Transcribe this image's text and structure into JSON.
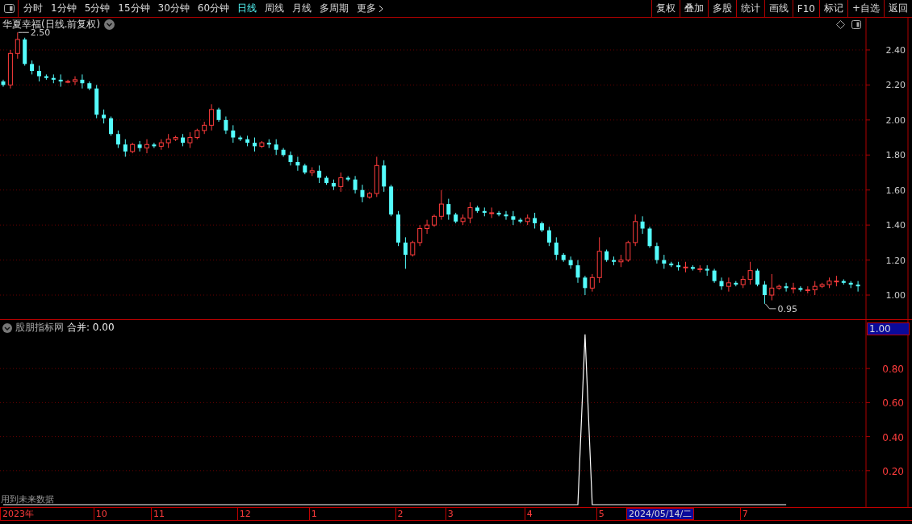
{
  "toolbar": {
    "periods": [
      {
        "label": "分时",
        "selected": false
      },
      {
        "label": "1分钟",
        "selected": false
      },
      {
        "label": "5分钟",
        "selected": false
      },
      {
        "label": "15分钟",
        "selected": false
      },
      {
        "label": "30分钟",
        "selected": false
      },
      {
        "label": "60分钟",
        "selected": false
      },
      {
        "label": "日线",
        "selected": true
      },
      {
        "label": "周线",
        "selected": false
      },
      {
        "label": "月线",
        "selected": false
      },
      {
        "label": "多周期",
        "selected": false
      },
      {
        "label": "更多",
        "selected": false
      }
    ],
    "buttons": [
      "复权",
      "叠加",
      "多股",
      "统计",
      "画线",
      "F10",
      "标记",
      "+自选",
      "返回"
    ]
  },
  "price_chart": {
    "title": "华夏幸福(日线.前复权)",
    "chart_data": {
      "type": "candlestick",
      "grid": true,
      "ylim": [
        0.862,
        2.584
      ],
      "yticks": [
        {
          "value": 2.4,
          "label": "2.40"
        },
        {
          "value": 2.2,
          "label": "2.20"
        },
        {
          "value": 2.0,
          "label": "2.00"
        },
        {
          "value": 1.8,
          "label": "1.80"
        },
        {
          "value": 1.6,
          "label": "1.60"
        },
        {
          "value": 1.4,
          "label": "1.40"
        },
        {
          "value": 1.2,
          "label": "1.20"
        },
        {
          "value": 1.0,
          "label": "1.00"
        }
      ],
      "ohlc": [
        [
          2.22,
          2.23,
          2.19,
          2.2
        ],
        [
          2.2,
          2.4,
          2.18,
          2.38
        ],
        [
          2.38,
          2.5,
          2.35,
          2.46
        ],
        [
          2.46,
          2.47,
          2.31,
          2.32
        ],
        [
          2.32,
          2.34,
          2.26,
          2.28
        ],
        [
          2.28,
          2.31,
          2.22,
          2.25
        ],
        [
          2.25,
          2.26,
          2.23,
          2.24
        ],
        [
          2.24,
          2.26,
          2.21,
          2.23
        ],
        [
          2.23,
          2.26,
          2.19,
          2.22
        ],
        [
          2.22,
          2.23,
          2.21,
          2.22
        ],
        [
          2.22,
          2.25,
          2.2,
          2.23
        ],
        [
          2.23,
          2.26,
          2.18,
          2.21
        ],
        [
          2.21,
          2.22,
          2.17,
          2.18
        ],
        [
          2.18,
          2.2,
          2.01,
          2.03
        ],
        [
          2.03,
          2.06,
          1.98,
          2.01
        ],
        [
          2.01,
          2.02,
          1.91,
          1.92
        ],
        [
          1.92,
          1.94,
          1.84,
          1.86
        ],
        [
          1.86,
          1.89,
          1.79,
          1.82
        ],
        [
          1.82,
          1.87,
          1.81,
          1.86
        ],
        [
          1.86,
          1.88,
          1.82,
          1.84
        ],
        [
          1.84,
          1.89,
          1.81,
          1.86
        ],
        [
          1.86,
          1.87,
          1.84,
          1.85
        ],
        [
          1.85,
          1.89,
          1.83,
          1.87
        ],
        [
          1.87,
          1.92,
          1.84,
          1.89
        ],
        [
          1.89,
          1.91,
          1.88,
          1.9
        ],
        [
          1.9,
          1.92,
          1.85,
          1.87
        ],
        [
          1.87,
          1.93,
          1.84,
          1.9
        ],
        [
          1.9,
          1.95,
          1.89,
          1.94
        ],
        [
          1.94,
          1.99,
          1.92,
          1.97
        ],
        [
          1.97,
          2.09,
          1.94,
          2.06
        ],
        [
          2.06,
          2.07,
          1.99,
          2.0
        ],
        [
          2.0,
          2.02,
          1.92,
          1.94
        ],
        [
          1.94,
          1.97,
          1.87,
          1.9
        ],
        [
          1.9,
          1.91,
          1.88,
          1.89
        ],
        [
          1.89,
          1.91,
          1.85,
          1.87
        ],
        [
          1.87,
          1.9,
          1.82,
          1.85
        ],
        [
          1.85,
          1.88,
          1.84,
          1.87
        ],
        [
          1.87,
          1.89,
          1.84,
          1.86
        ],
        [
          1.86,
          1.89,
          1.8,
          1.83
        ],
        [
          1.83,
          1.84,
          1.79,
          1.8
        ],
        [
          1.8,
          1.82,
          1.74,
          1.76
        ],
        [
          1.76,
          1.79,
          1.71,
          1.74
        ],
        [
          1.74,
          1.75,
          1.69,
          1.7
        ],
        [
          1.7,
          1.73,
          1.68,
          1.71
        ],
        [
          1.71,
          1.74,
          1.64,
          1.67
        ],
        [
          1.67,
          1.68,
          1.63,
          1.64
        ],
        [
          1.64,
          1.66,
          1.6,
          1.62
        ],
        [
          1.62,
          1.7,
          1.59,
          1.67
        ],
        [
          1.67,
          1.68,
          1.65,
          1.66
        ],
        [
          1.66,
          1.68,
          1.58,
          1.6
        ],
        [
          1.6,
          1.63,
          1.53,
          1.56
        ],
        [
          1.56,
          1.59,
          1.55,
          1.58
        ],
        [
          1.58,
          1.79,
          1.56,
          1.74
        ],
        [
          1.74,
          1.77,
          1.59,
          1.62
        ],
        [
          1.62,
          1.63,
          1.45,
          1.46
        ],
        [
          1.46,
          1.48,
          1.28,
          1.3
        ],
        [
          1.3,
          1.33,
          1.15,
          1.23
        ],
        [
          1.23,
          1.31,
          1.22,
          1.3
        ],
        [
          1.3,
          1.4,
          1.28,
          1.38
        ],
        [
          1.38,
          1.43,
          1.35,
          1.4
        ],
        [
          1.4,
          1.46,
          1.39,
          1.45
        ],
        [
          1.45,
          1.6,
          1.43,
          1.52
        ],
        [
          1.52,
          1.55,
          1.43,
          1.46
        ],
        [
          1.46,
          1.47,
          1.41,
          1.42
        ],
        [
          1.42,
          1.46,
          1.4,
          1.44
        ],
        [
          1.44,
          1.53,
          1.41,
          1.5
        ],
        [
          1.5,
          1.51,
          1.47,
          1.48
        ],
        [
          1.48,
          1.5,
          1.45,
          1.47
        ],
        [
          1.47,
          1.5,
          1.44,
          1.47
        ],
        [
          1.47,
          1.48,
          1.45,
          1.46
        ],
        [
          1.46,
          1.48,
          1.43,
          1.45
        ],
        [
          1.45,
          1.48,
          1.4,
          1.43
        ],
        [
          1.43,
          1.44,
          1.41,
          1.42
        ],
        [
          1.42,
          1.46,
          1.4,
          1.44
        ],
        [
          1.44,
          1.47,
          1.38,
          1.41
        ],
        [
          1.41,
          1.42,
          1.36,
          1.37
        ],
        [
          1.37,
          1.39,
          1.28,
          1.3
        ],
        [
          1.3,
          1.33,
          1.2,
          1.23
        ],
        [
          1.23,
          1.24,
          1.19,
          1.2
        ],
        [
          1.2,
          1.22,
          1.15,
          1.17
        ],
        [
          1.17,
          1.2,
          1.07,
          1.1
        ],
        [
          1.1,
          1.11,
          1.0,
          1.04
        ],
        [
          1.04,
          1.12,
          1.02,
          1.1
        ],
        [
          1.1,
          1.33,
          1.07,
          1.25
        ],
        [
          1.25,
          1.26,
          1.19,
          1.2
        ],
        [
          1.2,
          1.22,
          1.17,
          1.19
        ],
        [
          1.19,
          1.23,
          1.16,
          1.2
        ],
        [
          1.2,
          1.31,
          1.19,
          1.3
        ],
        [
          1.3,
          1.46,
          1.28,
          1.42
        ],
        [
          1.42,
          1.45,
          1.35,
          1.38
        ],
        [
          1.38,
          1.39,
          1.27,
          1.28
        ],
        [
          1.28,
          1.3,
          1.18,
          1.2
        ],
        [
          1.2,
          1.23,
          1.15,
          1.18
        ],
        [
          1.18,
          1.19,
          1.16,
          1.17
        ],
        [
          1.17,
          1.19,
          1.14,
          1.16
        ],
        [
          1.16,
          1.19,
          1.13,
          1.16
        ],
        [
          1.16,
          1.17,
          1.14,
          1.15
        ],
        [
          1.15,
          1.17,
          1.13,
          1.15
        ],
        [
          1.15,
          1.17,
          1.11,
          1.14
        ],
        [
          1.14,
          1.15,
          1.07,
          1.08
        ],
        [
          1.08,
          1.1,
          1.03,
          1.05
        ],
        [
          1.05,
          1.1,
          1.02,
          1.07
        ],
        [
          1.07,
          1.08,
          1.05,
          1.06
        ],
        [
          1.06,
          1.11,
          1.04,
          1.09
        ],
        [
          1.09,
          1.19,
          1.06,
          1.14
        ],
        [
          1.14,
          1.15,
          1.05,
          1.06
        ],
        [
          1.06,
          1.08,
          0.95,
          1.0
        ],
        [
          1.0,
          1.12,
          0.97,
          1.04
        ],
        [
          1.04,
          1.06,
          1.03,
          1.05
        ],
        [
          1.05,
          1.07,
          1.02,
          1.04
        ],
        [
          1.04,
          1.07,
          1.01,
          1.04
        ],
        [
          1.04,
          1.05,
          1.02,
          1.03
        ],
        [
          1.03,
          1.05,
          1.01,
          1.03
        ],
        [
          1.03,
          1.08,
          1.0,
          1.05
        ],
        [
          1.05,
          1.07,
          1.04,
          1.06
        ],
        [
          1.06,
          1.1,
          1.04,
          1.08
        ],
        [
          1.08,
          1.11,
          1.05,
          1.08
        ],
        [
          1.08,
          1.09,
          1.06,
          1.07
        ],
        [
          1.07,
          1.08,
          1.04,
          1.06
        ],
        [
          1.06,
          1.08,
          1.02,
          1.05
        ]
      ],
      "annotations": [
        "2.50",
        "0.95"
      ]
    }
  },
  "indicator": {
    "name": "股朋指标网",
    "reading": ": 0.00",
    "current_value": "1.00",
    "warning": "用到未来数据",
    "chart_data": {
      "type": "line",
      "grid": true,
      "ylim": [
        -0.014,
        1.085
      ],
      "yticks": [
        {
          "value": 0.8,
          "label": "0.80"
        },
        {
          "value": 0.6,
          "label": "0.60"
        },
        {
          "value": 0.4,
          "label": "0.40"
        },
        {
          "value": 0.2,
          "label": "0.20"
        }
      ],
      "series": [
        {
          "name": "合并",
          "color": "#ffffff",
          "values": [
            0,
            0,
            0,
            0,
            0,
            0,
            0,
            0,
            0,
            0,
            0,
            0,
            0,
            0,
            0,
            0,
            0,
            0,
            0,
            0,
            0,
            0,
            0,
            0,
            0,
            0,
            0,
            0,
            0,
            0,
            0,
            0,
            0,
            0,
            0,
            0,
            0,
            0,
            0,
            0,
            0,
            0,
            0,
            0,
            0,
            0,
            0,
            0,
            0,
            0,
            0,
            0,
            0,
            0,
            0,
            0,
            0,
            0,
            0,
            0,
            0,
            0,
            0,
            0,
            0,
            0,
            0,
            0,
            0,
            0,
            0,
            0,
            0,
            0,
            0,
            0,
            0,
            0,
            0,
            0,
            0,
            1,
            0,
            0,
            0,
            0,
            0,
            0,
            0,
            0,
            0,
            0,
            0,
            0,
            0,
            0,
            0,
            0,
            0,
            0,
            0,
            0,
            0,
            0,
            0,
            0,
            0,
            0,
            0,
            0,
            null,
            null,
            null,
            null,
            null,
            null,
            null,
            null,
            null,
            null
          ]
        }
      ]
    }
  },
  "date_axis": {
    "labels": [
      "2023年",
      "10",
      "11",
      "12",
      "1",
      "2",
      "3",
      "4",
      "5",
      "7"
    ],
    "cursor_date": "2024/05/14/二"
  }
}
